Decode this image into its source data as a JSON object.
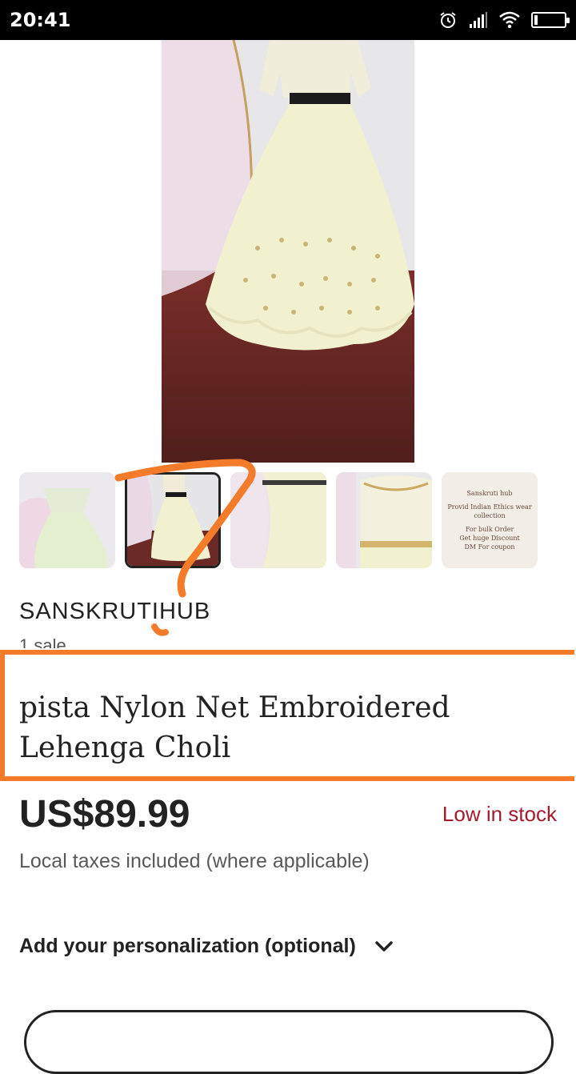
{
  "status_bar": {
    "time": "20:41",
    "icons": [
      "alarm-icon",
      "signal-icon",
      "wifi-icon",
      "battery-icon"
    ]
  },
  "gallery": {
    "selected_index": 1,
    "thumbnails": [
      {
        "label": ""
      },
      {
        "label": ""
      },
      {
        "label": ""
      },
      {
        "label": ""
      },
      {
        "lines": [
          "Sanskruti hub",
          "Provid Indian Ethics wear",
          "collection",
          "For bulk Order",
          "Get huge Discount",
          "DM For coupon"
        ]
      }
    ]
  },
  "shop": {
    "name": "SANSKRUTIHUB",
    "sales": "1 sale"
  },
  "product": {
    "title": "pista Nylon Net Embroidered Lehenga Choli",
    "price": "US$89.99",
    "stock_status": "Low in stock",
    "taxes_note": "Local taxes included (where applicable)"
  },
  "personalization": {
    "label": "Add your personalization (optional)"
  },
  "colors": {
    "annotation_orange": "#f37b29",
    "stock_red": "#a61a2e",
    "text": "#222222"
  }
}
